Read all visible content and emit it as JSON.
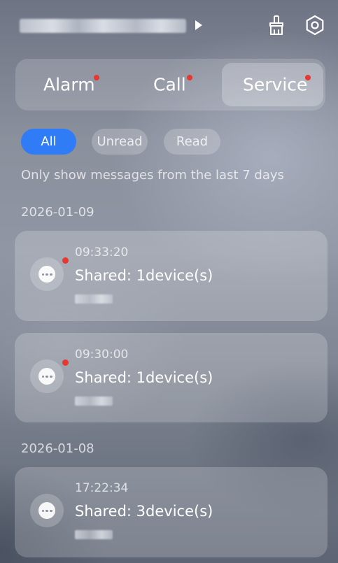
{
  "header": {
    "account_icon": "triangle-right-icon",
    "clean_icon": "broom-icon",
    "settings_icon": "hexagon-gear-icon"
  },
  "tabs": [
    {
      "label": "Alarm",
      "unread_dot": true
    },
    {
      "label": "Call",
      "unread_dot": true
    },
    {
      "label": "Service",
      "unread_dot": true,
      "selected": true
    }
  ],
  "filters": [
    {
      "label": "All",
      "selected": true
    },
    {
      "label": "Unread",
      "selected": false
    },
    {
      "label": "Read",
      "selected": false
    }
  ],
  "notice": "Only show messages from the last 7 days",
  "groups": [
    {
      "date": "2026-01-09",
      "messages": [
        {
          "time": "09:33:20",
          "title": "Shared: 1device(s)",
          "unread": true,
          "icon": "chat-bubble-icon"
        },
        {
          "time": "09:30:00",
          "title": "Shared: 1device(s)",
          "unread": true,
          "icon": "chat-bubble-icon"
        }
      ]
    },
    {
      "date": "2026-01-08",
      "messages": [
        {
          "time": "17:22:34",
          "title": "Shared: 3device(s)",
          "unread": false,
          "icon": "chat-bubble-icon"
        }
      ]
    }
  ],
  "colors": {
    "accent": "#2f7cf6",
    "unread_dot": "#e8372f"
  }
}
